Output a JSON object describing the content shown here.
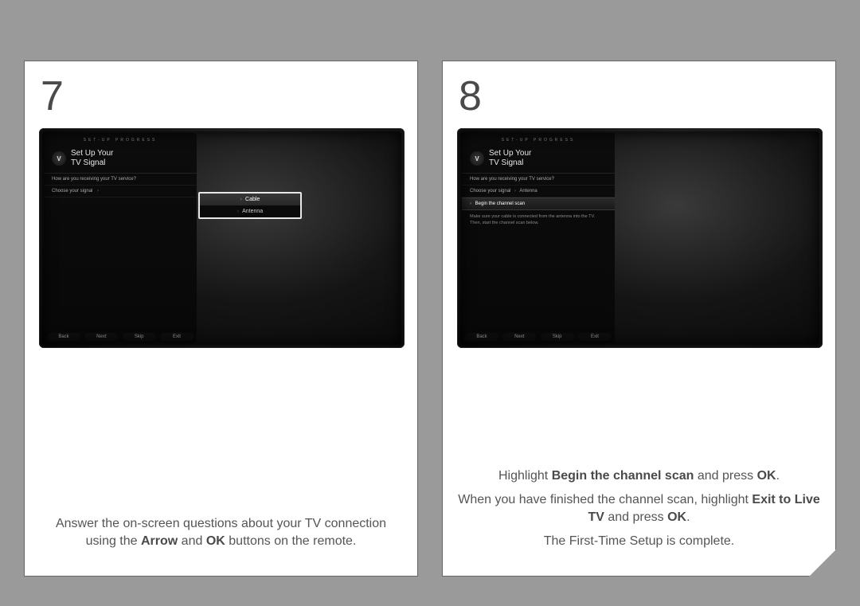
{
  "steps": {
    "left": {
      "number": "7",
      "caption_parts": [
        "Answer the on-screen questions about your TV connection using the ",
        "Arrow",
        " and ",
        "OK",
        " buttons on the remote."
      ],
      "screen": {
        "progress": "SET-UP PROGRESS",
        "title_line1": "Set Up Your",
        "title_line2": "TV Signal",
        "question": "How are you receiving your TV service?",
        "choose_label": "Choose your signal",
        "popup_options": [
          "Cable",
          "Antenna"
        ],
        "footer": [
          "Back",
          "Next",
          "Skip",
          "Exit"
        ]
      }
    },
    "right": {
      "number": "8",
      "caption_lines": [
        {
          "parts": [
            "Highlight ",
            "Begin the channel scan",
            " and press ",
            "OK",
            "."
          ]
        },
        {
          "parts": [
            "When you have finished the channel scan, highlight ",
            "Exit to Live TV",
            " and press ",
            "OK",
            "."
          ]
        },
        {
          "plain": "The First-Time Setup is complete."
        }
      ],
      "screen": {
        "progress": "SET-UP PROGRESS",
        "title_line1": "Set Up Your",
        "title_line2": "TV Signal",
        "question": "How are you receiving your TV service?",
        "choose_label": "Choose your signal",
        "choose_value": "Antenna",
        "begin_label": "Begin the channel scan",
        "hint": "Make sure your cable is connected from the antenna into the TV. Then, start the channel scan below.",
        "footer": [
          "Back",
          "Next",
          "Skip",
          "Exit"
        ]
      }
    }
  }
}
